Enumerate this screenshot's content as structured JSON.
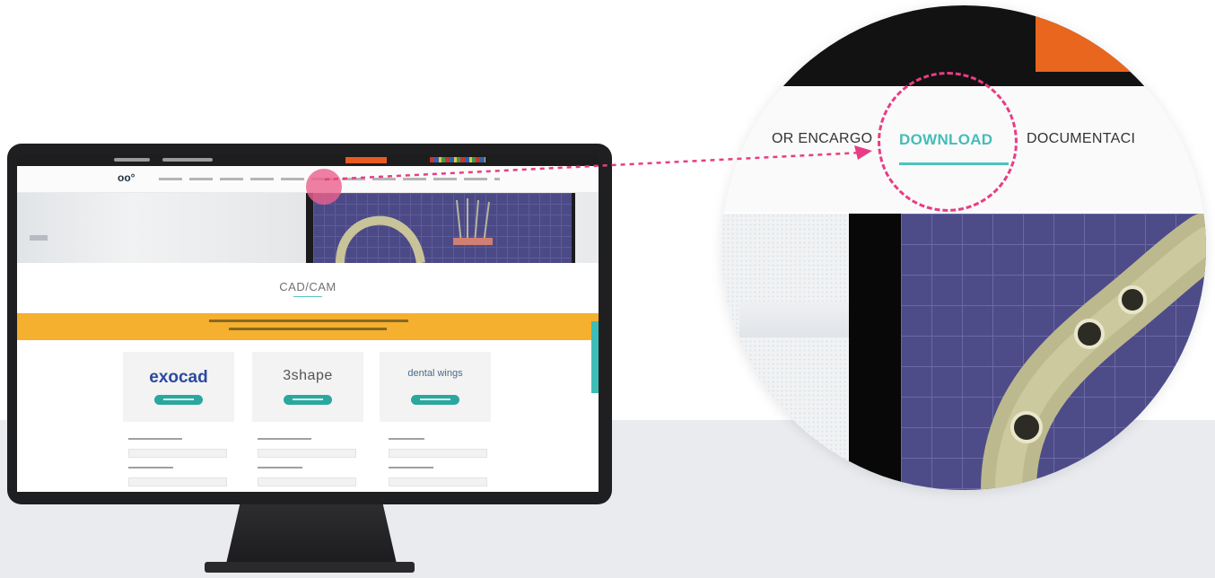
{
  "zoom": {
    "nav_items": [
      "OR ENCARGO",
      "DOWNLOAD",
      "DOCUMENTACI"
    ],
    "active_item": "DOWNLOAD"
  },
  "screen": {
    "section_title": "CAD/CAM",
    "software": [
      {
        "brand": "exocad"
      },
      {
        "brand": "3shape"
      },
      {
        "brand": "dental wings"
      }
    ]
  },
  "colors": {
    "accent_teal": "#46bcb8",
    "highlight_pink": "#e83d83",
    "banner_orange": "#f4b02e",
    "topbar_orange": "#e8661e"
  },
  "icons": [
    "arrow-pointer-icon",
    "zoom-dotted-circle"
  ]
}
